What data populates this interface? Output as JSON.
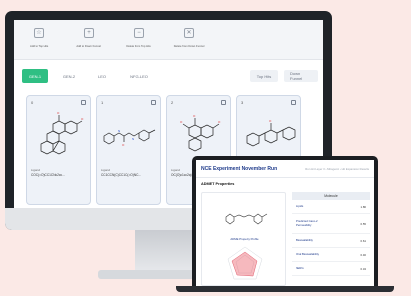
{
  "desktop": {
    "toolbar": [
      {
        "icon": "star-icon",
        "glyph": "☆",
        "label": "Add to Top Hits"
      },
      {
        "icon": "funnel-icon",
        "glyph": "+",
        "label": "Add to Down Funnel"
      },
      {
        "icon": "minus-icon",
        "glyph": "−",
        "label": "Delete from Top Hits"
      },
      {
        "icon": "trash-icon",
        "glyph": "✕",
        "label": "Delete from Down Funnel"
      }
    ],
    "tabs": [
      {
        "label": "GEN-1",
        "active": true
      },
      {
        "label": "GEN-2"
      },
      {
        "label": "LEO"
      },
      {
        "label": "NFG-LEO"
      },
      {
        "label": "Top Hits",
        "ghost": true
      },
      {
        "label": "Down Funnel",
        "ghost": true
      }
    ],
    "cards": [
      {
        "index": "0",
        "ligand_label": "Ligand",
        "smiles": "COC(=O)CC1CNc2cc..."
      },
      {
        "index": "1",
        "ligand_label": "Ligand",
        "smiles": "CC1CCN(C)CC1C(=O)NC..."
      },
      {
        "index": "2",
        "ligand_label": "Ligand",
        "smiles": "OC(O)c1cc2c(cc1)..."
      },
      {
        "index": "3",
        "ligand_label": "",
        "smiles": ""
      }
    ]
  },
  "laptop": {
    "title": "NCE Experiment November Run",
    "breadcrumb": "Run Hit Layer 3 › Mitogenic › Hit Expansion Results",
    "section": "ADMET Properties",
    "radar_caption": "ADME Property Profile",
    "table_header": "Molecule",
    "properties": [
      {
        "name": "Lipids",
        "value": "1.86"
      },
      {
        "name": "Predicted Caco-2 Permeability",
        "value": "0.55"
      },
      {
        "name": "Bioavailability",
        "value": "0.61"
      },
      {
        "name": "Oral Bioavailability",
        "value": "0.46"
      },
      {
        "name": "hERG",
        "value": "0.34"
      }
    ]
  },
  "colors": {
    "accent": "#2fbf83",
    "title": "#1e3a8a",
    "background": "#fbe9e6"
  }
}
